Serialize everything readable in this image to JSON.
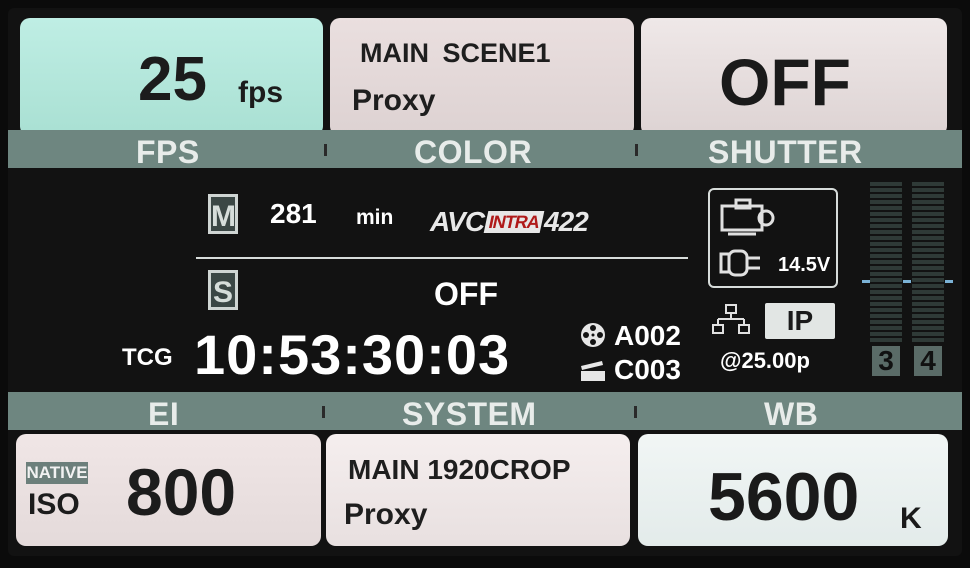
{
  "top_tiles": {
    "fps": {
      "value": "25",
      "unit": "fps",
      "band_label": "FPS"
    },
    "color": {
      "line1": "MAIN SCENE1",
      "line2": "Proxy",
      "band_label": "COLOR"
    },
    "shutter": {
      "value": "OFF",
      "band_label": "SHUTTER"
    }
  },
  "media": {
    "main_slot_letter": "M",
    "main_remaining_value": "281",
    "main_remaining_unit": "min",
    "codec_avc": "AVC",
    "codec_intra": "INTRA",
    "codec_422": "422",
    "sub_slot_letter": "S",
    "sub_status": "OFF"
  },
  "timecode": {
    "label": "TCG",
    "value": "10:53:30:03"
  },
  "clip": {
    "reel": "A002",
    "clip": "C003"
  },
  "power": {
    "voltage": "14.5V"
  },
  "network": {
    "mode": "IP",
    "rate": "@25.00p"
  },
  "audio_meters": [
    {
      "channel": "3",
      "level": 0.0
    },
    {
      "channel": "4",
      "level": 0.0
    }
  ],
  "bottom_tiles": {
    "ei": {
      "badge": "NATIVE",
      "iso_label": "ISO",
      "value": "800",
      "band_label": "EI"
    },
    "system": {
      "line1": "MAIN 1920CROP",
      "line2": "Proxy",
      "band_label": "SYSTEM"
    },
    "wb": {
      "value": "5600",
      "unit": "K",
      "band_label": "WB"
    }
  },
  "colors": {
    "band": "#6e8680",
    "fps_tile": "#bfeee4",
    "meter_marker": "#7bb2d6"
  }
}
